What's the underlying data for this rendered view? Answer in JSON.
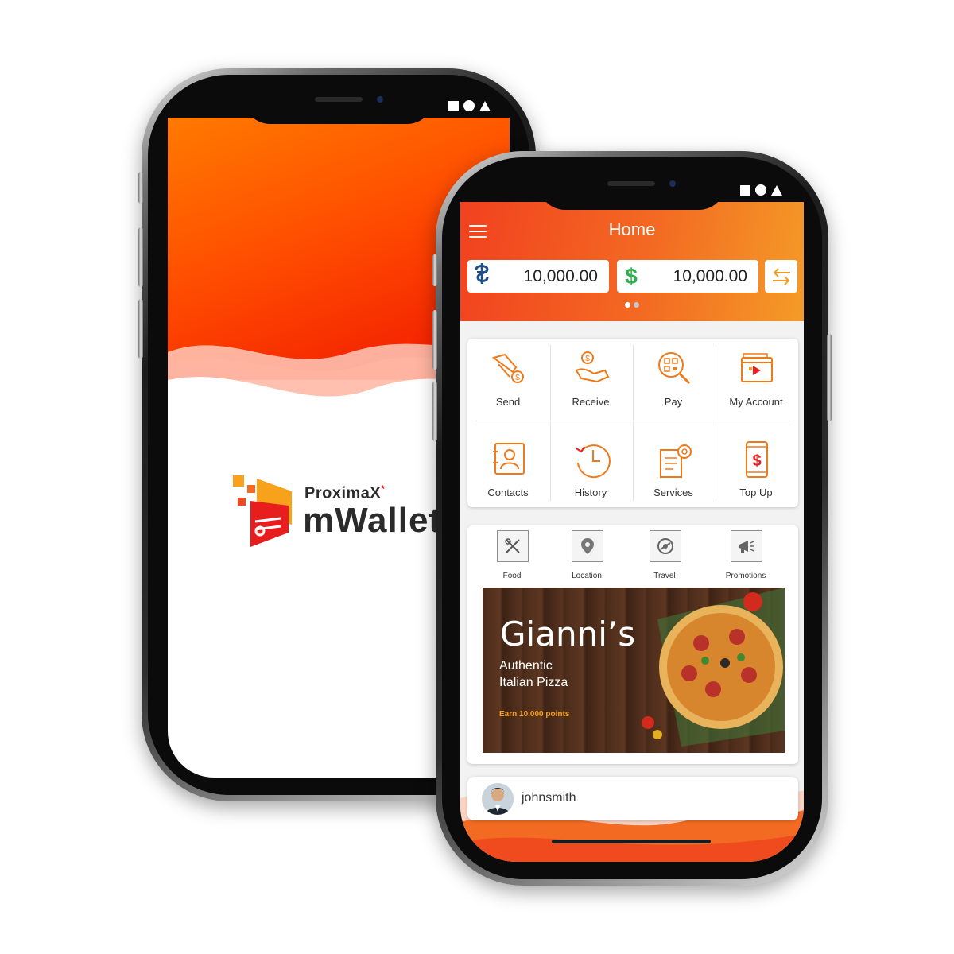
{
  "splash": {
    "brand_small": "ProximaX",
    "brand_mark": "*",
    "brand_big": "mWallet"
  },
  "home": {
    "title": "Home",
    "balances": [
      {
        "currency_icon": "xpx-currency-icon",
        "amount": "10,000.00",
        "color": "#1f4e8c"
      },
      {
        "currency_icon": "dollar-icon",
        "symbol": "$",
        "amount": "10,000.00",
        "color": "#2db34a"
      }
    ],
    "carousel_pages": 2,
    "carousel_active": 1,
    "actions": [
      {
        "label": "Send",
        "icon": "send-money-icon"
      },
      {
        "label": "Receive",
        "icon": "receive-money-icon"
      },
      {
        "label": "Pay",
        "icon": "qr-pay-icon"
      },
      {
        "label": "My Account",
        "icon": "wallet-account-icon"
      },
      {
        "label": "Contacts",
        "icon": "contacts-icon"
      },
      {
        "label": "History",
        "icon": "history-icon"
      },
      {
        "label": "Services",
        "icon": "services-icon"
      },
      {
        "label": "Top Up",
        "icon": "top-up-icon"
      }
    ],
    "categories": [
      {
        "label": "Food",
        "icon": "food-icon"
      },
      {
        "label": "Location",
        "icon": "location-icon"
      },
      {
        "label": "Travel",
        "icon": "travel-icon"
      },
      {
        "label": "Promotions",
        "icon": "promotions-icon"
      }
    ],
    "banner": {
      "title": "Gianni’s",
      "line1": "Authentic",
      "line2": "Italian Pizza",
      "points": "Earn 10,000 points"
    },
    "user": {
      "name": "johnsmith"
    }
  },
  "colors": {
    "accent_orange": "#f36a22",
    "accent_red": "#f01400",
    "icon_orange": "#f07a1a"
  }
}
